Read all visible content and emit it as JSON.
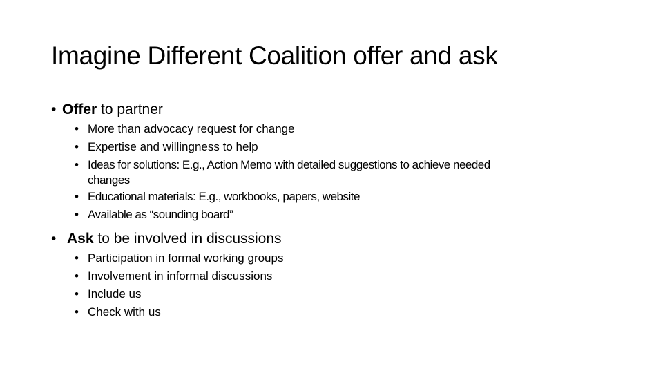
{
  "slide": {
    "title": "Imagine Different Coalition offer and ask",
    "bullet_glyph": "•",
    "sections": [
      {
        "bold": "Offer",
        "rest": " to partner",
        "items": [
          "More than advocacy request for change",
          "Expertise and willingness to help",
          "Ideas for solutions:  E.g., Action Memo with detailed suggestions to achieve needed",
          "changes",
          "Educational materials:  E.g., workbooks, papers, website",
          "Available as “sounding board”"
        ]
      },
      {
        "bold": "Ask",
        "rest": " to be involved in discussions",
        "items": [
          "Participation in formal working groups",
          "Involvement in informal discussions",
          "Include us",
          "Check with us"
        ]
      }
    ]
  }
}
